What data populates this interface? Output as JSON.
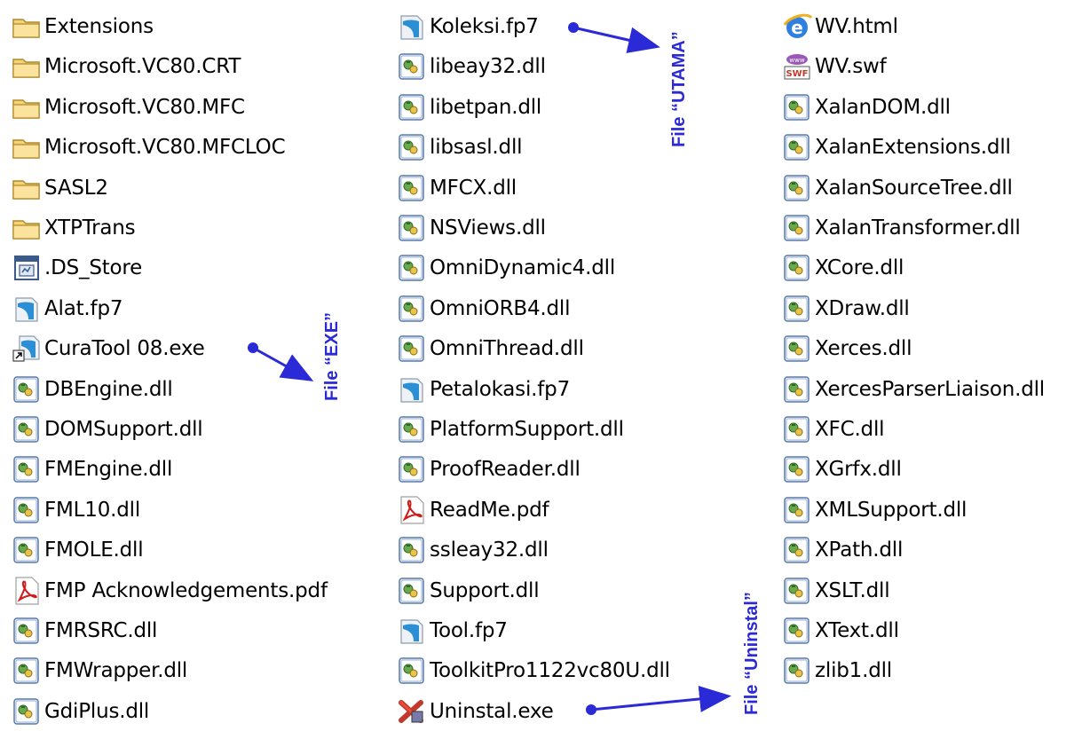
{
  "columns": [
    {
      "items": [
        {
          "icon": "folder-icon",
          "label": "Extensions"
        },
        {
          "icon": "folder-icon",
          "label": "Microsoft.VC80.CRT"
        },
        {
          "icon": "folder-icon",
          "label": "Microsoft.VC80.MFC"
        },
        {
          "icon": "folder-icon",
          "label": "Microsoft.VC80.MFCLOC"
        },
        {
          "icon": "folder-icon",
          "label": "SASL2"
        },
        {
          "icon": "folder-icon",
          "label": "XTPTrans"
        },
        {
          "icon": "ds-store-icon",
          "label": ".DS_Store"
        },
        {
          "icon": "filemaker-icon",
          "label": "Alat.fp7"
        },
        {
          "icon": "exe-shortcut-icon",
          "label": "CuraTool 08.exe"
        },
        {
          "icon": "dll-icon",
          "label": "DBEngine.dll"
        },
        {
          "icon": "dll-icon",
          "label": "DOMSupport.dll"
        },
        {
          "icon": "dll-icon",
          "label": "FMEngine.dll"
        },
        {
          "icon": "dll-icon",
          "label": "FML10.dll"
        },
        {
          "icon": "dll-icon",
          "label": "FMOLE.dll"
        },
        {
          "icon": "pdf-icon",
          "label": "FMP Acknowledgements.pdf"
        },
        {
          "icon": "dll-icon",
          "label": "FMRSRC.dll"
        },
        {
          "icon": "dll-icon",
          "label": "FMWrapper.dll"
        },
        {
          "icon": "dll-icon",
          "label": "GdiPlus.dll"
        }
      ]
    },
    {
      "items": [
        {
          "icon": "filemaker-icon",
          "label": "Koleksi.fp7"
        },
        {
          "icon": "dll-icon",
          "label": "libeay32.dll"
        },
        {
          "icon": "dll-icon",
          "label": "libetpan.dll"
        },
        {
          "icon": "dll-icon",
          "label": "libsasl.dll"
        },
        {
          "icon": "dll-icon",
          "label": "MFCX.dll"
        },
        {
          "icon": "dll-icon",
          "label": "NSViews.dll"
        },
        {
          "icon": "dll-icon",
          "label": "OmniDynamic4.dll"
        },
        {
          "icon": "dll-icon",
          "label": "OmniORB4.dll"
        },
        {
          "icon": "dll-icon",
          "label": "OmniThread.dll"
        },
        {
          "icon": "filemaker-icon",
          "label": "Petalokasi.fp7"
        },
        {
          "icon": "dll-icon",
          "label": "PlatformSupport.dll"
        },
        {
          "icon": "dll-icon",
          "label": "ProofReader.dll"
        },
        {
          "icon": "pdf-icon",
          "label": "ReadMe.pdf"
        },
        {
          "icon": "dll-icon",
          "label": "ssleay32.dll"
        },
        {
          "icon": "dll-icon",
          "label": "Support.dll"
        },
        {
          "icon": "filemaker-icon",
          "label": "Tool.fp7"
        },
        {
          "icon": "dll-icon",
          "label": "ToolkitPro1122vc80U.dll"
        },
        {
          "icon": "uninstall-icon",
          "label": "Uninstal.exe"
        }
      ]
    },
    {
      "items": [
        {
          "icon": "ie-html-icon",
          "label": "WV.html"
        },
        {
          "icon": "swf-icon",
          "label": "WV.swf"
        },
        {
          "icon": "dll-icon",
          "label": "XalanDOM.dll"
        },
        {
          "icon": "dll-icon",
          "label": "XalanExtensions.dll"
        },
        {
          "icon": "dll-icon",
          "label": "XalanSourceTree.dll"
        },
        {
          "icon": "dll-icon",
          "label": "XalanTransformer.dll"
        },
        {
          "icon": "dll-icon",
          "label": "XCore.dll"
        },
        {
          "icon": "dll-icon",
          "label": "XDraw.dll"
        },
        {
          "icon": "dll-icon",
          "label": "Xerces.dll"
        },
        {
          "icon": "dll-icon",
          "label": "XercesParserLiaison.dll"
        },
        {
          "icon": "dll-icon",
          "label": "XFC.dll"
        },
        {
          "icon": "dll-icon",
          "label": "XGrfx.dll"
        },
        {
          "icon": "dll-icon",
          "label": "XMLSupport.dll"
        },
        {
          "icon": "dll-icon",
          "label": "XPath.dll"
        },
        {
          "icon": "dll-icon",
          "label": "XSLT.dll"
        },
        {
          "icon": "dll-icon",
          "label": "XText.dll"
        },
        {
          "icon": "dll-icon",
          "label": "zlib1.dll"
        }
      ]
    }
  ],
  "annotations": {
    "utama": "File “UTAMA”",
    "exe": "File “EXE”",
    "uninstal": "File “Uninstal”"
  },
  "colors": {
    "annotation": "#2a2ad6",
    "folder": "#f4d37a",
    "dll_green": "#3a8a2a",
    "pdf_red": "#d11a1a"
  }
}
